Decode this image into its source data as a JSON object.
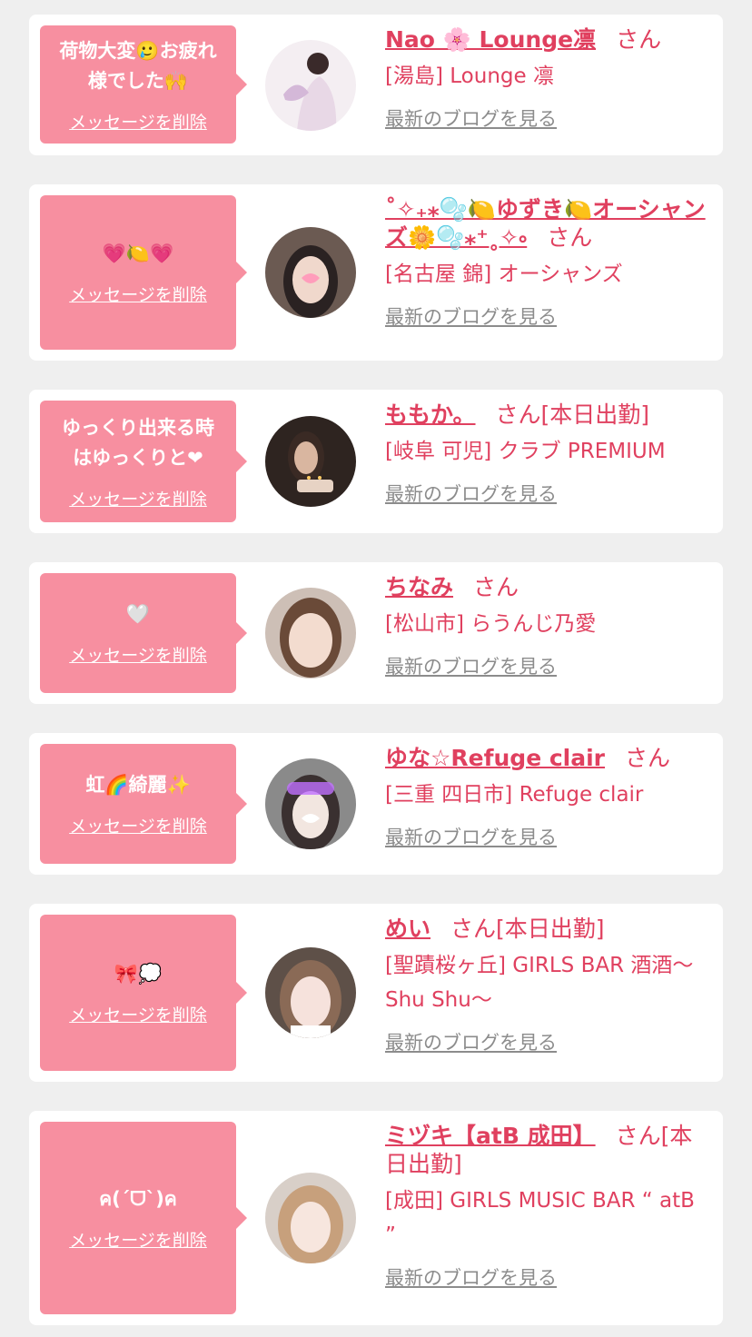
{
  "delete_label": "メッセージを削除",
  "blog_label": "最新のブログを見る",
  "honorific": "さん",
  "colors": {
    "accent": "#e0405f",
    "bubble": "#f78fa0",
    "link_gray": "#8c8c8c",
    "background": "#efefef"
  },
  "cards": [
    {
      "message": "荷物大変🥲お疲れ\n様でした🙌",
      "name": "Nao 🌸 Lounge凛",
      "status": "",
      "shop": "[湯島] Lounge 凛"
    },
    {
      "message": "💗🍋💗",
      "name": "˚✧₊⁎🫧🍋ゆずき🍋オーシャンズ🌼🫧⁎⁺˳✧༚",
      "status": "",
      "shop": "[名古屋 錦] オーシャンズ"
    },
    {
      "message": "ゆっくり出来る時\nはゆっくりと❤︎",
      "name": "ももか。",
      "status": "[本日出勤]",
      "shop": "[岐阜 可児] クラブ PREMIUM"
    },
    {
      "message": "🤍",
      "name": "ちなみ",
      "status": "",
      "shop": "[松山市] らうんじ乃愛"
    },
    {
      "message": "虹🌈綺麗✨",
      "name": "ゆな☆Refuge clair",
      "status": "",
      "shop": "[三重 四日市] Refuge clair"
    },
    {
      "message": "🎀💭",
      "name": "めい",
      "status": "[本日出勤]",
      "shop": "[聖蹟桜ヶ丘] GIRLS BAR 酒酒〜Shu Shu〜"
    },
    {
      "message": "ค(ˊᗜˋ)ค",
      "name": "ミヅキ【atB 成田】",
      "status": "[本日出勤]",
      "shop": "[成田] GIRLS MUSIC BAR “ atB ”"
    }
  ]
}
